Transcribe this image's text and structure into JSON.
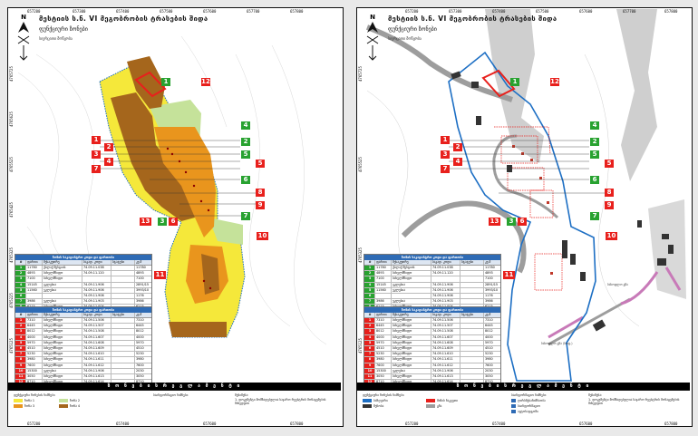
{
  "title": "მესტიის ს.ნ. VI მეგობრობის ტრასების შიდა",
  "subtitle": "ფუნქციური ზონები",
  "subtitle2": "სივრცითი მოწყობა",
  "bottom_bar": "ზ ო ნ ე ბ ი ს   რ ე გ ლ ა მ ე ნ ტ ი",
  "coords_top": [
    "657200",
    "657300",
    "657400",
    "657500",
    "657600",
    "657700",
    "657800",
    "657900"
  ],
  "coords_bottom": [
    "657200",
    "657300",
    "657400",
    "657500",
    "657600",
    "657700",
    "657800",
    "657900"
  ],
  "coords_left": [
    "4765725",
    "4765625",
    "4765525",
    "4765425",
    "4765325",
    "4765225",
    "4765125",
    "4765025",
    "4764925",
    "4764825",
    "4764725"
  ],
  "colors": {
    "yellow": "#f5e83a",
    "orange": "#e9951d",
    "brown": "#a5661c",
    "lightgreen": "#c5e29a",
    "red": "#e8201c",
    "green": "#28a230",
    "blue": "#1d6fc4",
    "grey": "#9d9d9d",
    "pink": "#c87ab8"
  },
  "table_green": {
    "header": "ზონის საკადასტრო კოდი და ფართობი",
    "columns": [
      "#",
      "ფართი",
      "მესაკუთრე",
      "საკად. კოდი",
      "სტატუსი",
      "კვ.მ"
    ],
    "rows": [
      {
        "id": "1",
        "area": "11780",
        "owner": "ქალაქ მესტიის",
        "code": "74.09.11.038",
        "status": "",
        "total": "11780"
      },
      {
        "id": "2",
        "area": "4893",
        "owner": "სახელმწიფო",
        "code": "74.09.11.120",
        "status": "",
        "total": "4893"
      },
      {
        "id": "3",
        "area": "7100",
        "owner": "სახელმწიფო",
        "code": "",
        "status": "",
        "total": "7100"
      },
      {
        "id": "4",
        "area": "15145",
        "owner": "ეკლესია",
        "code": "74.09.11.906",
        "status": "",
        "total": "2891/15"
      },
      {
        "id": "5",
        "area": "11560",
        "owner": "ეკლესია",
        "code": "74.09.11.906",
        "status": "",
        "total": "3993/10"
      },
      {
        "id": "6",
        "area": "",
        "owner": "",
        "code": "74.09.11.906",
        "status": "",
        "total": "1176"
      },
      {
        "id": "7",
        "area": "3986",
        "owner": "ეკლესია",
        "code": "74.09.11.903",
        "status": "",
        "total": "3986"
      },
      {
        "id": "8",
        "area": "6215",
        "owner": "სახელმწიფო",
        "code": "74.09.11.004",
        "status": "",
        "total": "6215"
      }
    ]
  },
  "table_red": {
    "header": "ზონის საკადასტრო კოდი და ფართობი",
    "columns": [
      "#",
      "ფართი",
      "მესაკუთრე",
      "საკად. კოდი",
      "სტატუსი",
      "კვ.მ"
    ],
    "rows": [
      {
        "id": "1",
        "area": "7310",
        "owner": "სახელმწიფო",
        "code": "74.09.11.506",
        "status": "",
        "total": "7310"
      },
      {
        "id": "2",
        "area": "6445",
        "owner": "სახელმწიფო",
        "code": "74.09.11.507",
        "status": "",
        "total": "6445"
      },
      {
        "id": "3",
        "area": "8012",
        "owner": "სახელმწიფო",
        "code": "74.09.11.508",
        "status": "",
        "total": "8012"
      },
      {
        "id": "4",
        "area": "4000",
        "owner": "სახელმწიფო",
        "code": "74.09.11.607",
        "status": "",
        "total": "4000"
      },
      {
        "id": "5",
        "area": "5970",
        "owner": "სახელმწიფო",
        "code": "74.09.11.608",
        "status": "",
        "total": "5970"
      },
      {
        "id": "6",
        "area": "4510",
        "owner": "სახელმწიფო",
        "code": "74.09.11.609",
        "status": "",
        "total": "4510"
      },
      {
        "id": "7",
        "area": "5230",
        "owner": "სახელმწიფო",
        "code": "74.09.11.610",
        "status": "",
        "total": "5230"
      },
      {
        "id": "8",
        "area": "3980",
        "owner": "სახელმწიფო",
        "code": "74.09.11.611",
        "status": "",
        "total": "3980"
      },
      {
        "id": "9",
        "area": "7600",
        "owner": "სახელმწიფო",
        "code": "74.09.11.612",
        "status": "",
        "total": "7600"
      },
      {
        "id": "10",
        "area": "15300",
        "owner": "ეკლესია",
        "code": "74.09.11.906",
        "status": "",
        "total": "2030"
      },
      {
        "id": "11",
        "area": "3050",
        "owner": "სახელმწიფო",
        "code": "74.09.11.613",
        "status": "",
        "total": "3050"
      },
      {
        "id": "12",
        "area": "8710",
        "owner": "სახელმწიფო",
        "code": "74.09.11.614",
        "status": "",
        "total": "8710"
      },
      {
        "id": "13",
        "area": "4530",
        "owner": "სახელმწიფო",
        "code": "74.09.11.615",
        "status": "",
        "total": "4530"
      }
    ]
  },
  "legend_left": {
    "heading": "ფუნქციური ზონების ნიშნები",
    "items": [
      {
        "label": "ზონა 1",
        "color": "#f5e83a"
      },
      {
        "label": "ზონა 2",
        "color": "#c5e29a"
      },
      {
        "label": "ზონა 3",
        "color": "#e9951d"
      },
      {
        "label": "ზონა 4",
        "color": "#a5661c"
      }
    ],
    "mid_heading": "საინფორმაციო ნიშნები",
    "note_heading": "შენიშვნა:",
    "note_text": "1. დოკუმენტი მომზადებულია საჯარო რეესტრის მონაცემების მიხედვით"
  },
  "legend_right": {
    "heading": "ფუნქციური ზონების ნიშნები",
    "items": [
      {
        "label": "საზღვარი",
        "color": "#1d6fc4"
      },
      {
        "label": "მიწის ნაკვეთი",
        "color": "#e8201c"
      },
      {
        "label": "შენობა",
        "color": "#333333"
      },
      {
        "label": "გზა",
        "color": "#9d9d9d"
      }
    ],
    "mid_heading": "საინფორმაციო ნიშნები",
    "icons": [
      "ღირსშესანიშნაობა",
      "საინფორმაციო",
      "ავტოსადგომი"
    ],
    "note_heading": "შენიშვნა:",
    "note_text": "1. დოკუმენტი მომზადებულია საჯარო რეესტრის მონაცემების მიხედვით"
  },
  "map_labels": {
    "road_label_1": "სასოფლო გზა",
    "road_label_2": "სასოფლო გზა (სოფ.)"
  },
  "zone_tags": [
    {
      "n": "1",
      "color": "green",
      "side": "both"
    },
    {
      "n": "12",
      "color": "red",
      "side": "both"
    },
    {
      "n": "4",
      "color": "green",
      "side": "both"
    },
    {
      "n": "1",
      "color": "red",
      "side": "both"
    },
    {
      "n": "2",
      "color": "red",
      "side": "both"
    },
    {
      "n": "2",
      "color": "green",
      "side": "both"
    },
    {
      "n": "3",
      "color": "red",
      "side": "both"
    },
    {
      "n": "4",
      "color": "red",
      "side": "both"
    },
    {
      "n": "5",
      "color": "green",
      "side": "both"
    },
    {
      "n": "5",
      "color": "red",
      "side": "both"
    },
    {
      "n": "7",
      "color": "red",
      "side": "both"
    },
    {
      "n": "6",
      "color": "green",
      "side": "both"
    },
    {
      "n": "8",
      "color": "red",
      "side": "both"
    },
    {
      "n": "9",
      "color": "red",
      "side": "both"
    },
    {
      "n": "7",
      "color": "green",
      "side": "both"
    },
    {
      "n": "13",
      "color": "red",
      "side": "both"
    },
    {
      "n": "3",
      "color": "green",
      "side": "both"
    },
    {
      "n": "6",
      "color": "red",
      "side": "both"
    },
    {
      "n": "10",
      "color": "red",
      "side": "both"
    },
    {
      "n": "11",
      "color": "red",
      "side": "both"
    }
  ]
}
